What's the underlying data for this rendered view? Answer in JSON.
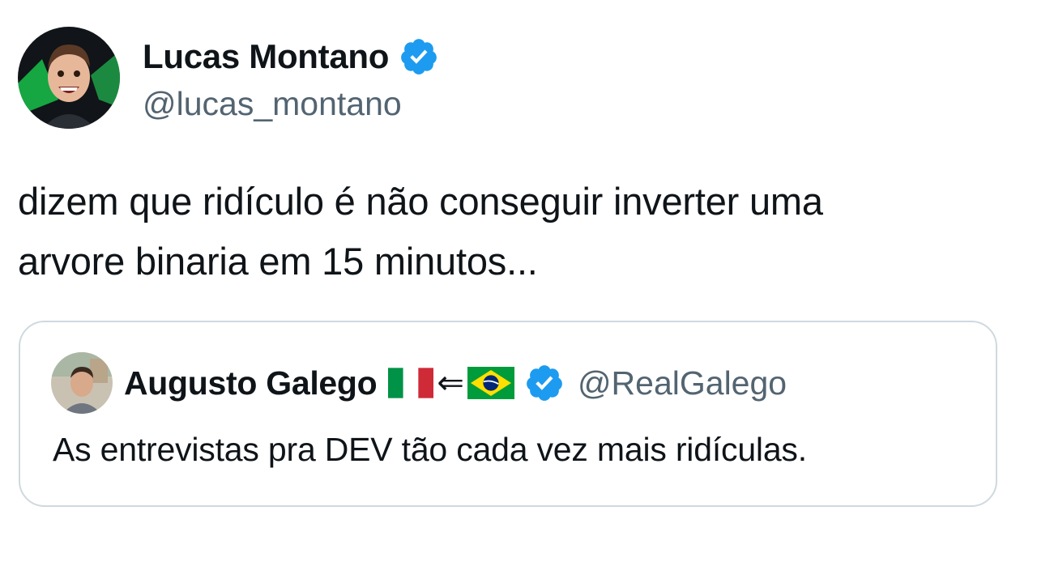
{
  "author": {
    "name": "Lucas Montano",
    "handle": "@lucas_montano",
    "verified": true
  },
  "tweet": {
    "text_line1": "dizem que ridículo é não conseguir inverter uma",
    "text_line2": "arvore binaria em 15 minutos..."
  },
  "quoted": {
    "name": "Augusto Galego",
    "flags": [
      "italy-flag",
      "brazil-flag"
    ],
    "arrow": "⇐",
    "handle": "@RealGalego",
    "verified": true,
    "text": "As entrevistas pra DEV tão cada vez mais ridículas."
  },
  "colors": {
    "verified_blue": "#1d9bf0",
    "handle_gray": "#536471",
    "border": "#cfd9de"
  }
}
